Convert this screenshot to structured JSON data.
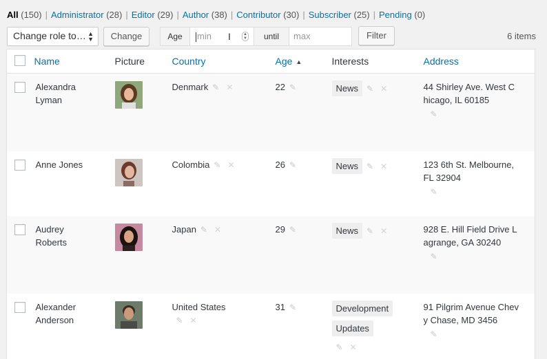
{
  "views": [
    {
      "label": "All",
      "count": "(150)",
      "current": true
    },
    {
      "label": "Administrator",
      "count": "(28)"
    },
    {
      "label": "Editor",
      "count": "(29)"
    },
    {
      "label": "Author",
      "count": "(38)"
    },
    {
      "label": "Contributor",
      "count": "(30)"
    },
    {
      "label": "Subscriber",
      "count": "(25)"
    },
    {
      "label": "Pending",
      "count": "(0)"
    }
  ],
  "toolbar": {
    "role_select": "Change role to…",
    "change_label": "Change",
    "age_label": "Age",
    "min_placeholder": "min",
    "until_label": "until",
    "max_placeholder": "max",
    "filter_label": "Filter",
    "items_count": "6 items"
  },
  "columns": {
    "name": "Name",
    "picture": "Picture",
    "country": "Country",
    "age": "Age",
    "interests": "Interests",
    "address": "Address"
  },
  "rows": [
    {
      "first": "Alexandra",
      "last": "Lyman",
      "country": "Denmark",
      "age": "22",
      "interests": [
        "News"
      ],
      "address1": "44 Shirley Ave. West C",
      "address2": "hicago, IL 60185",
      "avatar": {
        "hair": "#5a3a22",
        "skin": "#e8b79a",
        "bg": "#8fa77a"
      }
    },
    {
      "first": "Anne Jones",
      "last": "",
      "country": "Colombia",
      "age": "26",
      "interests": [
        "News"
      ],
      "address1": "123 6th St. Melbourne,",
      "address2": "FL 32904",
      "avatar": {
        "hair": "#6b3a2a",
        "skin": "#e2b6a0",
        "bg": "#cfc5c0"
      }
    },
    {
      "first": "Audrey",
      "last": "Roberts",
      "country": "Japan",
      "age": "29",
      "interests": [
        "News"
      ],
      "address1": "928 E. Hill Field Drive L",
      "address2": "agrange, GA 30240",
      "avatar": {
        "hair": "#1c120e",
        "skin": "#d9a283",
        "bg": "#c58aa0"
      }
    },
    {
      "first": "Alexander",
      "last": "Anderson",
      "country": "United States",
      "age": "31",
      "interests": [
        "Development",
        "Updates"
      ],
      "address1": "91 Pilgrim Avenue Chev",
      "address2": "y Chase, MD 3456",
      "avatar": {
        "hair": "#3b2c22",
        "skin": "#c99a7c",
        "bg": "#6e7a6a"
      }
    }
  ]
}
